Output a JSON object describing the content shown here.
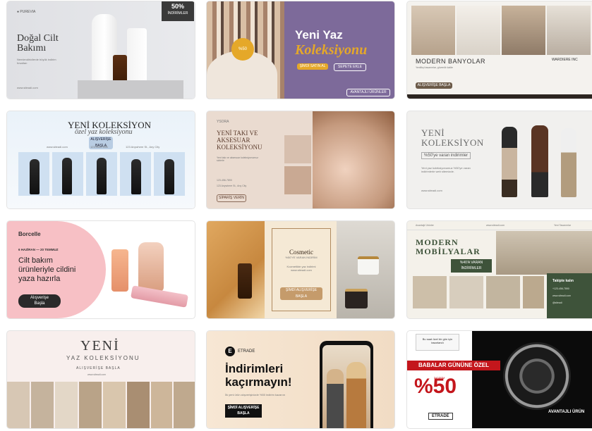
{
  "grid": {
    "c1": {
      "brand": "PUREVIA",
      "badge_pct": "50%",
      "badge_text": "İNDİRİMLER",
      "title_line1": "Doğal Cilt",
      "title_line2": "Bakımı",
      "desc": "Nemlendiricilerde büyük indirim fırsatları",
      "url": "www.siteadi.com"
    },
    "c2": {
      "title1": "Yeni Yaz",
      "title2": "Koleksiyonu",
      "circle_label": "%50",
      "btn1": "ŞİMDİ SATIN AL",
      "btn2": "SEPETE EKLE",
      "bottom_btn": "AVANTAJLI ÜRÜNLER"
    },
    "c3": {
      "title": "MODERN BANYOLAR",
      "brand": "WARDIERE INC",
      "sub": "Yenilikçi tasarımlar, güvenilir kalite",
      "btn": "ALIŞVERİŞE BAŞLA"
    },
    "c4": {
      "title": "YENİ KOLEKSİYON",
      "script": "özel yaz koleksiyonu",
      "chip": "ALIŞVERİŞE BAŞLA",
      "url": "www.siteadi.com",
      "phone": "123-456-7890",
      "address": "123 Anywhere St., Any City"
    },
    "c5": {
      "brand": "YSORA",
      "title1": "YENİ TAKI VE",
      "title2": "AKSESUAR",
      "title3": "KOLEKSİYONU",
      "desc": "Yeni takı ve aksesuar koleksiyonumuz sizlerle",
      "phone": "123-456-7890",
      "address": "123 Anywhere St., Any City",
      "btn": "SİPARİŞ VERİN"
    },
    "c6": {
      "title1": "YENİ",
      "title2": "KOLEKSİYON",
      "tag": "%50'ye varan indirimler",
      "desc": "Yeni yaz koleksiyonumuz %50'ye varan indirimlerle web sitemizde.",
      "url": "www.siteadi.com"
    },
    "c7": {
      "brand": "Borcelle",
      "dates": "6 HAZİRAN — 20 TEMMUZ",
      "headline1": "Cilt bakım",
      "headline2": "ürünleriyle cildini",
      "headline3": "yaza hazırla",
      "btn1": "Alışverişe",
      "btn2": "Başla"
    },
    "c8": {
      "title": "Cosmetic",
      "sub": "%50'YE VARAN İNDİRİM",
      "mid1": "Kozmetikte yaz indirimi",
      "mid2": "www.siteadi.com",
      "btn": "ŞİMDİ ALIŞVERİŞE BAŞLA"
    },
    "c9": {
      "topbar1": "Avantajlı Ürünler",
      "topbar2": "www.siteadi.com",
      "topbar3": "Yeni Tasarımlar",
      "title1": "MODERN",
      "title2": "MOBİLYALAR",
      "badge1": "%40'A VARAN",
      "badge2": "İNDİRİMLER",
      "contact": "Takipte kalın",
      "phone": "+123-456-7890",
      "url": "www.siteadi.com",
      "social": "@siteadi"
    },
    "c10": {
      "title1": "YENİ",
      "title2": "YAZ KOLEKSİYONU",
      "sub": "ALIŞVERİŞE BAŞLA",
      "url": "www.siteadi.com"
    },
    "c11": {
      "brand_letter": "E",
      "brand": "ETRADE",
      "title1": "İndirimleri",
      "title2": "kaçırmayın!",
      "desc": "İlk yeni ürün alışverişinizde %50 indirim kazanın",
      "btn1": "ŞİMDİ ALIŞVERİŞE",
      "btn2": "BAŞLA"
    },
    "c12": {
      "note": "Bu saat özel bir gün için tasarlandı",
      "banner": "BABALAR GÜNÜNE ÖZEL",
      "pct": "%50",
      "pct_small": "İNDİRİM",
      "brand": "ETRADE",
      "btn": "AVANTAJLI ÜRÜN"
    }
  },
  "colors": {
    "purple": "#7d6a9a",
    "gold": "#e5a829",
    "pink": "#f7c0c5",
    "green": "#3e533a",
    "red": "#c4161c"
  }
}
